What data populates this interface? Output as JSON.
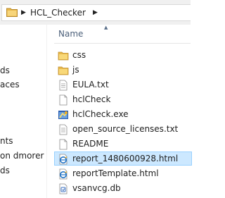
{
  "address": {
    "crumbs": [
      "HCL_Checker"
    ]
  },
  "nav": {
    "items": [
      "ds",
      "aces",
      "nts",
      "on dmorer",
      "ds"
    ]
  },
  "columns": {
    "name": "Name"
  },
  "files": [
    {
      "name": "css",
      "icon": "folder-icon"
    },
    {
      "name": "js",
      "icon": "folder-icon"
    },
    {
      "name": "EULA.txt",
      "icon": "text-file-icon"
    },
    {
      "name": "hclCheck",
      "icon": "blank-file-icon"
    },
    {
      "name": "hclCheck.exe",
      "icon": "exe-icon"
    },
    {
      "name": "open_source_licenses.txt",
      "icon": "text-file-icon"
    },
    {
      "name": "README",
      "icon": "blank-file-icon"
    },
    {
      "name": "report_1480600928.html",
      "icon": "html-file-icon",
      "selected": true
    },
    {
      "name": "reportTemplate.html",
      "icon": "html-file-icon"
    },
    {
      "name": "vsanvcg.db",
      "icon": "db-file-icon"
    }
  ],
  "colors": {
    "selection_bg": "#cce8ff",
    "selection_border": "#99d1ff",
    "folder": "#e8b84a",
    "header_text": "#4c607a"
  }
}
